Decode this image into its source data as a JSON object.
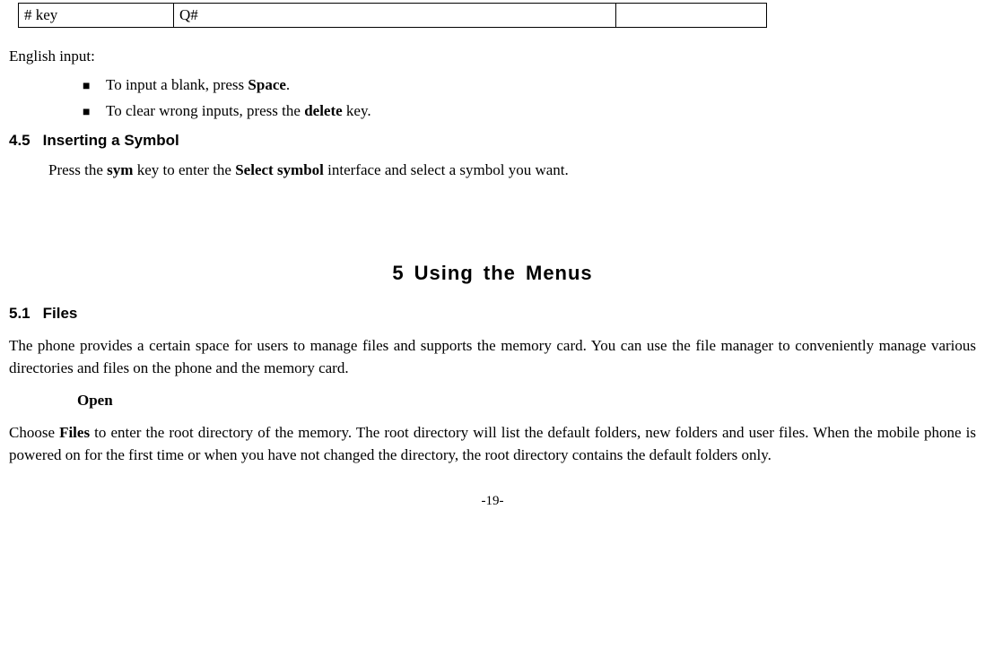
{
  "table": {
    "col1": "# key",
    "col2": "Q#",
    "col3": ""
  },
  "english_input": {
    "intro": "English input:",
    "bullet1_pre": "To input a blank, press ",
    "bullet1_bold": "Space",
    "bullet1_post": ".",
    "bullet2_pre": "To clear wrong inputs, press the ",
    "bullet2_bold": "delete",
    "bullet2_post": " key."
  },
  "section45": {
    "num": "4.5",
    "title": "Inserting a Symbol",
    "body_pre": "Press the ",
    "sym": "sym",
    "body_mid": " key to enter the ",
    "selectsymbol": "Select symbol",
    "body_post": " interface and select a symbol you want."
  },
  "chapter5": {
    "title": "5  Using the Menus"
  },
  "section51": {
    "num": "5.1",
    "title": "Files",
    "body": "The phone provides a certain space for users to manage files and supports the memory card. You can use the file manager to conveniently manage various directories and files on the phone and the memory card.",
    "open_title": "Open",
    "open_pre": "Choose ",
    "open_bold": "Files",
    "open_post": " to enter the root directory of the memory. The root directory will list the default folders, new folders and user files. When the mobile phone is powered on for the first time or when you have not changed the directory, the root directory contains the default folders only."
  },
  "pagenum": "-19-"
}
